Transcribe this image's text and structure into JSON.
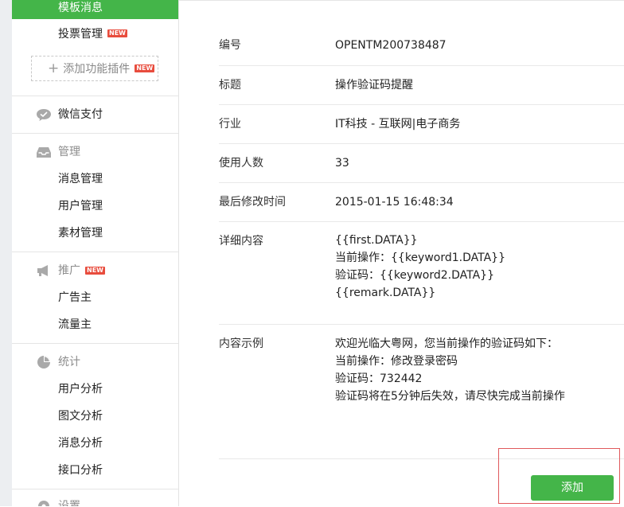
{
  "sidebar": {
    "active_item": "模板消息",
    "vote_item": "投票管理",
    "new_badge": "NEW",
    "add_plugin": "添加功能插件",
    "sections": {
      "pay": "微信支付",
      "manage": "管理",
      "promote": "推广",
      "stats": "统计",
      "settings": "设置"
    },
    "manage_items": [
      "消息管理",
      "用户管理",
      "素材管理"
    ],
    "promote_items": [
      "广告主",
      "流量主"
    ],
    "stats_items": [
      "用户分析",
      "图文分析",
      "消息分析",
      "接口分析"
    ]
  },
  "detail": {
    "id": {
      "label": "编号",
      "value": "OPENTM200738487"
    },
    "title": {
      "label": "标题",
      "value": "操作验证码提醒"
    },
    "industry": {
      "label": "行业",
      "value": "IT科技 - 互联网|电子商务"
    },
    "users": {
      "label": "使用人数",
      "value": "33"
    },
    "modified": {
      "label": "最后修改时间",
      "value": "2015-01-15 16:48:34"
    },
    "content": {
      "label": "详细内容",
      "lines": [
        "{{first.DATA}}",
        "当前操作：{{keyword1.DATA}}",
        "验证码：{{keyword2.DATA}}",
        "{{remark.DATA}}"
      ]
    },
    "example": {
      "label": "内容示例",
      "lines": [
        "欢迎光临大粤网，您当前操作的验证码如下：",
        "当前操作：修改登录密码",
        "验证码：732442",
        "验证码将在5分钟后失效，请尽快完成当前操作"
      ]
    }
  },
  "actions": {
    "add_label": "添加"
  },
  "colors": {
    "accent": "#44b549",
    "badge": "#e84c3d",
    "highlight": "#e0595c"
  }
}
